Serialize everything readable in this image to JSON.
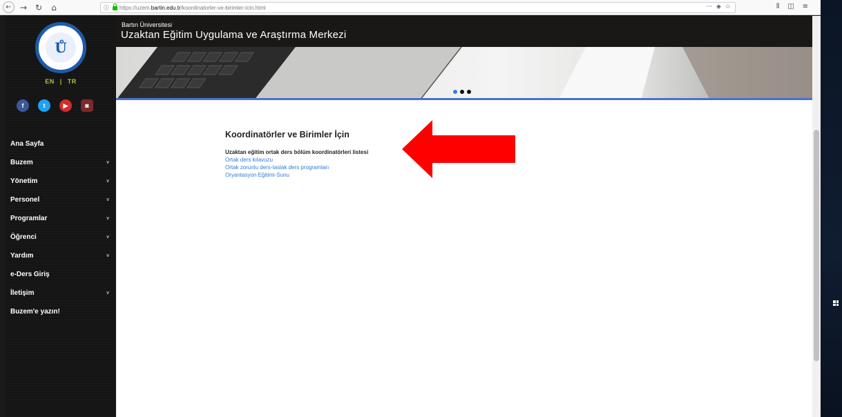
{
  "browser": {
    "url_prefix": "https://uzem.",
    "url_host": "bartin.edu.tr",
    "url_path": "/koordinatorler-ve-birimler-icin.html",
    "back_icon": "←",
    "forward_icon": "→",
    "reload_icon": "↻",
    "home_icon": "⌂",
    "more_icon": "···",
    "pocket_icon": "◈",
    "bookmark_icon": "☆",
    "library_icon": "⫴",
    "sidebar_icon": "◫",
    "menu_icon": "≡"
  },
  "site": {
    "org": "Bartın Üniversitesi",
    "title": "Uzaktan Eğitim Uygulama ve Araştırma Merkezi",
    "logo_text": "Ů",
    "lang": {
      "en": "EN",
      "sep": "|",
      "tr": "TR"
    },
    "socials": [
      "f",
      "t",
      "▶",
      "◙"
    ]
  },
  "menu": [
    {
      "label": "Ana Sayfa",
      "chev": ""
    },
    {
      "label": "Buzem",
      "chev": "v"
    },
    {
      "label": "Yönetim",
      "chev": "v"
    },
    {
      "label": "Personel",
      "chev": "v"
    },
    {
      "label": "Programlar",
      "chev": "v"
    },
    {
      "label": "Öğrenci",
      "chev": "v"
    },
    {
      "label": "Yardım",
      "chev": "v"
    },
    {
      "label": "e-Ders Giriş",
      "chev": ""
    },
    {
      "label": "İletişim",
      "chev": "v"
    },
    {
      "label": "Buzem'e yazın!",
      "chev": ""
    }
  ],
  "content": {
    "heading": "Koordinatörler ve Birimler İçin",
    "intro": "Uzaktan eğitim ortak ders bölüm koordinatörleri listesi",
    "links": [
      "Ortak ders kılavuzu",
      "Ortak zorunlu ders-taslak ders programları",
      "Oryantasyon Eğitimi-Sunu"
    ]
  },
  "colors": {
    "arrow": "#ff0000",
    "link": "#2f7bd6",
    "accent": "#4a6fd3",
    "lang": "#a4c639"
  },
  "carousel": {
    "slides": 3,
    "active_index": 0
  }
}
